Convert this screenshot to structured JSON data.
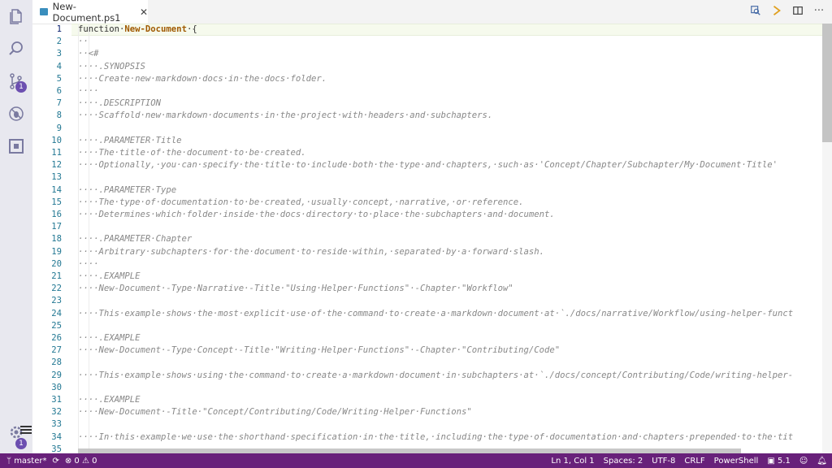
{
  "tab": {
    "filename": "New-Document.ps1",
    "close_glyph": "✕"
  },
  "activity_bar": {
    "items": [
      {
        "name": "explorer-icon"
      },
      {
        "name": "search-icon"
      },
      {
        "name": "source-control-icon",
        "badge": "1"
      },
      {
        "name": "debug-icon"
      },
      {
        "name": "extensions-icon"
      }
    ],
    "settings_badge": "1"
  },
  "editor": {
    "line_numbers": [
      "1",
      "2",
      "3",
      "4",
      "5",
      "6",
      "7",
      "8",
      "9",
      "10",
      "11",
      "12",
      "13",
      "14",
      "15",
      "16",
      "17",
      "18",
      "19",
      "20",
      "21",
      "22",
      "23",
      "24",
      "25",
      "26",
      "27",
      "28",
      "29",
      "30",
      "31",
      "32",
      "33",
      "34",
      "35"
    ],
    "line1_keyword": "function·",
    "line1_name": "New-Document",
    "line1_rest": "·{",
    "lines": [
      "",
      "··",
      "··<#",
      "····.SYNOPSIS",
      "····Create·new·markdown·docs·in·the·docs·folder.",
      "····",
      "····.DESCRIPTION",
      "····Scaffold·new·markdown·documents·in·the·project·with·headers·and·subchapters.",
      "",
      "····.PARAMETER·Title",
      "····The·title·of·the·document·to·be·created.",
      "····Optionally,·you·can·specify·the·title·to·include·both·the·type·and·chapters,·such·as·'Concept/Chapter/Subchapter/My·Document·Title'",
      "",
      "····.PARAMETER·Type",
      "····The·type·of·documentation·to·be·created,·usually·concept,·narrative,·or·reference.",
      "····Determines·which·folder·inside·the·docs·directory·to·place·the·subchapters·and·document.",
      "",
      "····.PARAMETER·Chapter",
      "····Arbitrary·subchapters·for·the·document·to·reside·within,·separated·by·a·forward·slash.",
      "····",
      "····.EXAMPLE",
      "····New-Document·-Type·Narrative·-Title·\"Using·Helper·Functions\"·-Chapter·\"Workflow\"",
      "",
      "····This·example·shows·the·most·explicit·use·of·the·command·to·create·a·markdown·document·at·`./docs/narrative/Workflow/using-helper-funct",
      "",
      "····.EXAMPLE",
      "····New-Document·-Type·Concept·-Title·\"Writing·Helper·Functions\"·-Chapter·\"Contributing/Code\"",
      "",
      "····This·example·shows·using·the·command·to·create·a·markdown·document·in·subchapters·at·`./docs/concept/Contributing/Code/writing-helper-",
      "",
      "····.EXAMPLE",
      "····New-Document·-Title·\"Concept/Contributing/Code/Writing·Helper·Functions\"",
      "",
      "····In·this·example·we·use·the·shorthand·specification·in·the·title,·including·the·type·of·documentation·and·chapters·prepended·to·the·tit",
      ""
    ]
  },
  "statusbar": {
    "branch": "master*",
    "errors": "0",
    "warnings": "0",
    "position": "Ln 1, Col 1",
    "spaces": "Spaces: 2",
    "encoding": "UTF-8",
    "eol": "CRLF",
    "language": "PowerShell",
    "ps_version": "5.1"
  }
}
